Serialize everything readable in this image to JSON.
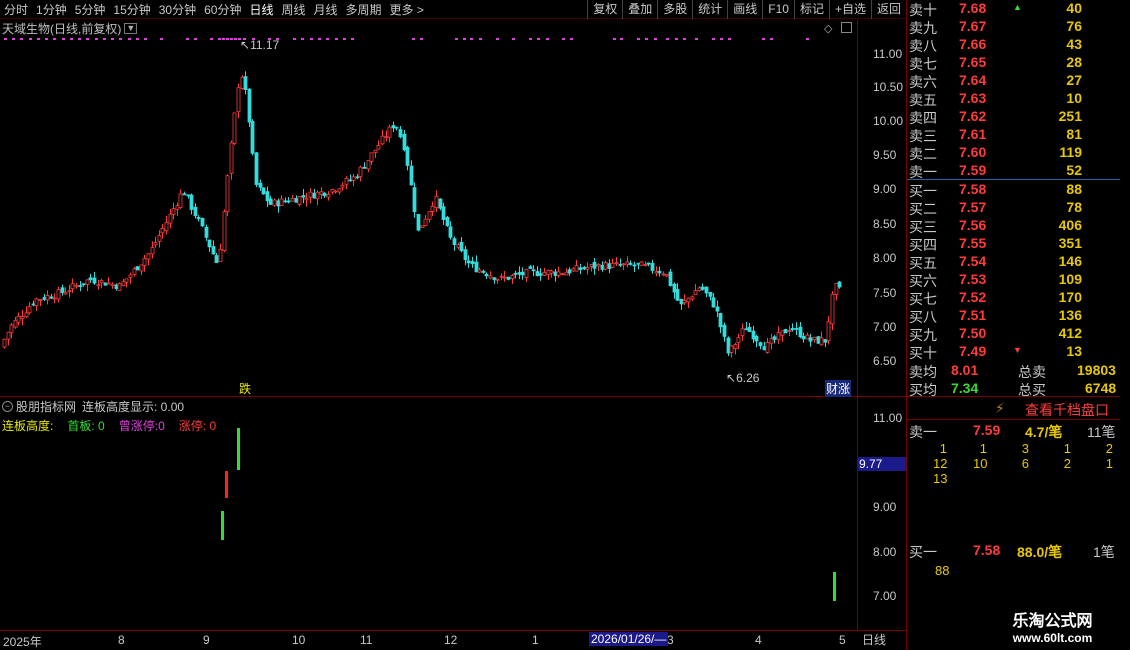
{
  "toolbar": {
    "period_tabs": [
      "分时",
      "1分钟",
      "5分钟",
      "15分钟",
      "30分钟",
      "60分钟",
      "日线",
      "周线",
      "月线",
      "多周期",
      "更多 >"
    ],
    "active_period": "日线",
    "buttons": [
      "复权",
      "叠加",
      "多股",
      "统计",
      "画线",
      "F10",
      "标记",
      "+自选",
      "返回"
    ]
  },
  "chart": {
    "title": "天域生物(日线,前复权)",
    "price_ticks": [
      "11.00",
      "10.50",
      "10.00",
      "9.50",
      "9.00",
      "8.50",
      "8.00",
      "7.50",
      "7.00",
      "6.50"
    ],
    "high_marker": "11.17",
    "low_marker": "6.26",
    "event_label_left": "跌",
    "event_label_right": "财涨",
    "colors": {
      "up": "#ff3b3b",
      "down": "#33dddd",
      "dots": "#e040e0"
    }
  },
  "indicator": {
    "name": "股朋指标网",
    "param": "连板高度显示: 0.00",
    "legend": [
      {
        "label": "连板高度:",
        "value": "",
        "color": "#e8e800"
      },
      {
        "label": "首板:",
        "value": "0",
        "color": "#33dd33"
      },
      {
        "label": "曾涨停:",
        "value": "0",
        "color": "#e040e0"
      },
      {
        "label": "涨停:",
        "value": "0",
        "color": "#ff3b3b"
      }
    ],
    "axis_ticks": [
      "11.00",
      "9.00",
      "8.00",
      "7.00"
    ],
    "cursor_value": "9.77"
  },
  "time_axis": {
    "labels": [
      "2025年",
      "8",
      "9",
      "10",
      "11",
      "12",
      "1",
      "3",
      "4",
      "5"
    ],
    "cursor_date": "2026/01/26/—",
    "period": "日线"
  },
  "order_book": {
    "asks": [
      {
        "label": "卖十",
        "price": "7.68",
        "vol": "40"
      },
      {
        "label": "卖九",
        "price": "7.67",
        "vol": "76"
      },
      {
        "label": "卖八",
        "price": "7.66",
        "vol": "43"
      },
      {
        "label": "卖七",
        "price": "7.65",
        "vol": "28"
      },
      {
        "label": "卖六",
        "price": "7.64",
        "vol": "27"
      },
      {
        "label": "卖五",
        "price": "7.63",
        "vol": "10"
      },
      {
        "label": "卖四",
        "price": "7.62",
        "vol": "251"
      },
      {
        "label": "卖三",
        "price": "7.61",
        "vol": "81"
      },
      {
        "label": "卖二",
        "price": "7.60",
        "vol": "119"
      },
      {
        "label": "卖一",
        "price": "7.59",
        "vol": "52"
      }
    ],
    "bids": [
      {
        "label": "买一",
        "price": "7.58",
        "vol": "88"
      },
      {
        "label": "买二",
        "price": "7.57",
        "vol": "78"
      },
      {
        "label": "买三",
        "price": "7.56",
        "vol": "406"
      },
      {
        "label": "买四",
        "price": "7.55",
        "vol": "351"
      },
      {
        "label": "买五",
        "price": "7.54",
        "vol": "146"
      },
      {
        "label": "买六",
        "price": "7.53",
        "vol": "109"
      },
      {
        "label": "买七",
        "price": "7.52",
        "vol": "170"
      },
      {
        "label": "买八",
        "price": "7.51",
        "vol": "136"
      },
      {
        "label": "买九",
        "price": "7.50",
        "vol": "412"
      },
      {
        "label": "买十",
        "price": "7.49",
        "vol": "13"
      }
    ]
  },
  "summary": {
    "sell_avg_label": "卖均",
    "sell_avg": "8.01",
    "total_sell_label": "总卖",
    "total_sell": "19803",
    "buy_avg_label": "买均",
    "buy_avg": "7.34",
    "total_buy_label": "总买",
    "total_buy": "6748"
  },
  "qianda": {
    "link": "查看千档盘口",
    "sell_label": "卖一",
    "sell_price": "7.59",
    "sell_per": "4.7/笔",
    "sell_count": "11笔",
    "sell_queue": [
      [
        "1",
        "1",
        "3",
        "1",
        "2"
      ],
      [
        "12",
        "10",
        "6",
        "2",
        "1"
      ],
      [
        "13"
      ]
    ],
    "buy_label": "买一",
    "buy_price": "7.58",
    "buy_per": "88.0/笔",
    "buy_count": "1笔",
    "buy_queue": [
      [
        "88"
      ]
    ]
  },
  "watermark": {
    "title": "乐淘公式网",
    "url": "www.60lt.com"
  }
}
